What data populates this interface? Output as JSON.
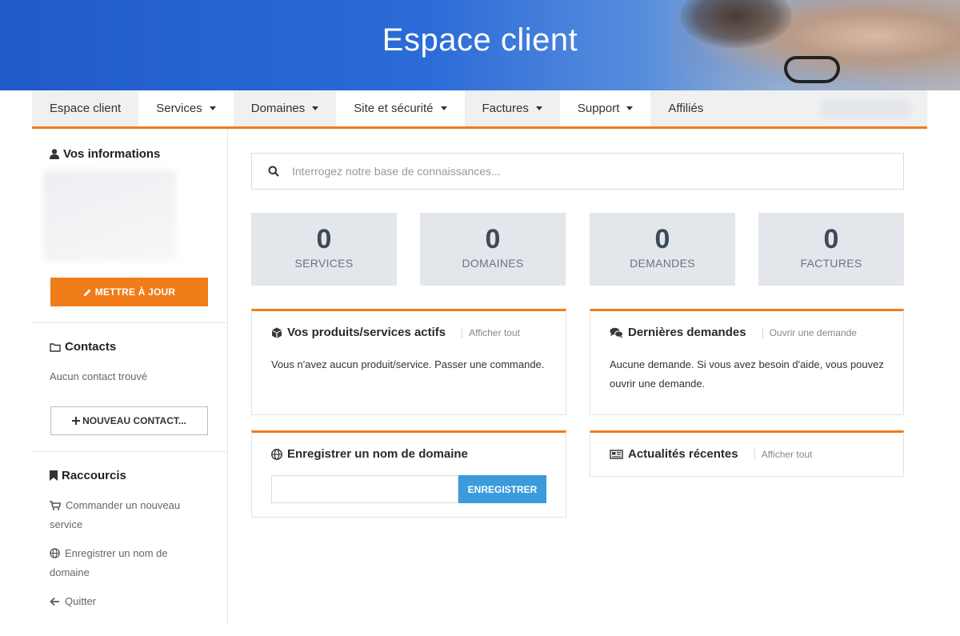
{
  "banner": {
    "title": "Espace client"
  },
  "nav": {
    "items": [
      {
        "label": "Espace client"
      },
      {
        "label": "Services"
      },
      {
        "label": "Domaines"
      },
      {
        "label": "Site et sécurité"
      },
      {
        "label": "Factures"
      },
      {
        "label": "Support"
      },
      {
        "label": "Affiliés"
      }
    ]
  },
  "sidebar": {
    "info_title": "Vos informations",
    "update_button": "METTRE À JOUR",
    "contacts_title": "Contacts",
    "contacts_empty": "Aucun contact trouvé",
    "new_contact_button": "NOUVEAU CONTACT...",
    "shortcuts_title": "Raccourcis",
    "shortcuts": [
      {
        "label": "Commander un nouveau service",
        "icon": "cart-icon"
      },
      {
        "label": "Enregistrer un nom de domaine",
        "icon": "globe-icon"
      },
      {
        "label": "Quitter",
        "icon": "arrow-left-icon"
      }
    ]
  },
  "search": {
    "placeholder": "Interrogez notre base de connaissances..."
  },
  "stats": [
    {
      "value": "0",
      "label": "SERVICES"
    },
    {
      "value": "0",
      "label": "DOMAINES"
    },
    {
      "value": "0",
      "label": "DEMANDES"
    },
    {
      "value": "0",
      "label": "FACTURES"
    }
  ],
  "panels": {
    "products": {
      "title": "Vos produits/services actifs",
      "link": "Afficher tout",
      "body": "Vous n'avez aucun produit/service. Passer une commande."
    },
    "tickets": {
      "title": "Dernières demandes",
      "link": "Ouvrir une demande",
      "body": "Aucune demande. Si vous avez besoin d'aide, vous pouvez ouvrir une demande."
    },
    "domain": {
      "title": "Enregistrer un nom de domaine",
      "button": "ENREGISTRER"
    },
    "news": {
      "title": "Actualités récentes",
      "link": "Afficher tout"
    }
  },
  "colors": {
    "accent": "#f07d1a",
    "primary_button": "#3b9bdc",
    "banner": "#1f5bc7",
    "tile_bg": "#e3e6eb"
  }
}
